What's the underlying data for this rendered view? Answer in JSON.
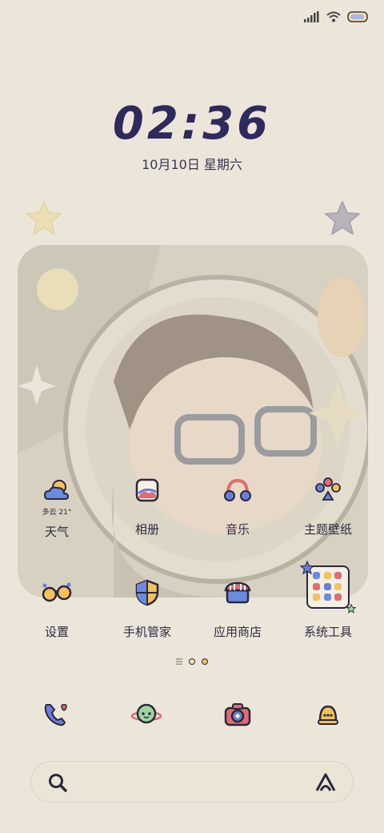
{
  "status_bar": {
    "signal": "signal-icon",
    "wifi": "wifi-icon",
    "battery": "battery-icon"
  },
  "clock": {
    "time": "02:36",
    "date": "10月10日 星期六"
  },
  "weather": {
    "summary": "多云 21°"
  },
  "apps_row1": [
    {
      "label": "天气",
      "icon": "weather-cloud-sun-icon"
    },
    {
      "label": "相册",
      "icon": "gallery-icon"
    },
    {
      "label": "音乐",
      "icon": "headphones-icon"
    },
    {
      "label": "主题壁纸",
      "icon": "theme-palette-icon"
    }
  ],
  "apps_row2": [
    {
      "label": "设置",
      "icon": "settings-glasses-icon"
    },
    {
      "label": "手机管家",
      "icon": "security-shield-icon"
    },
    {
      "label": "应用商店",
      "icon": "app-store-icon"
    },
    {
      "label": "系统工具",
      "icon": "folder-icon"
    }
  ],
  "dock": [
    {
      "name": "phone",
      "icon": "phone-icon"
    },
    {
      "name": "browser",
      "icon": "planet-icon"
    },
    {
      "name": "camera",
      "icon": "camera-icon"
    },
    {
      "name": "messages",
      "icon": "bell-chat-icon"
    }
  ],
  "colors": {
    "background": "#ece6da",
    "clock": "#2e2a5c",
    "accent_yellow": "#f4c15a",
    "accent_blue": "#6a7ed6"
  }
}
